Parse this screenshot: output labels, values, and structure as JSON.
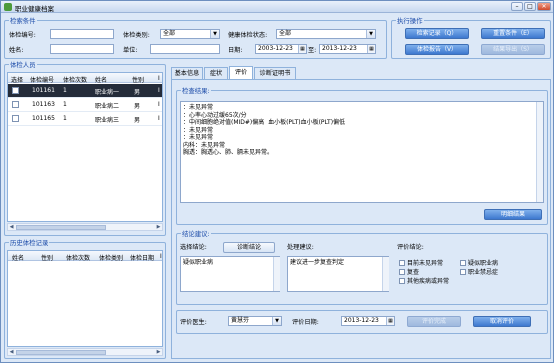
{
  "window": {
    "title": "职业健康档案",
    "min": "–",
    "max": "□",
    "close": "✕"
  },
  "search": {
    "legend": "检索条件",
    "exam_no_label": "体检编号:",
    "exam_no_value": "",
    "exam_type_label": "体检类别:",
    "exam_type_value": "全部",
    "health_status_label": "健康体检状态:",
    "health_status_value": "全部",
    "name_label": "姓名:",
    "name_value": "",
    "unit_label": "单位:",
    "unit_value": "",
    "date_label": "日期:",
    "date_from": "2003-12-23",
    "date_to_label": "至:",
    "date_to": "2013-12-23"
  },
  "actions": {
    "legend": "执行操作",
    "search_btn": "检索记录（Q）",
    "reset_btn": "重置条件（E）",
    "report_btn": "体检报告（V）",
    "export_btn": "结果导出（S）"
  },
  "people": {
    "legend": "体检人员",
    "columns": [
      "选择",
      "体检编号",
      "体检次数",
      "姓名",
      "性别",
      "I"
    ],
    "rows": [
      {
        "no": "101161",
        "count": "1",
        "name": "职业病一",
        "sex": "男",
        "extra": "I",
        "selected": true
      },
      {
        "no": "101163",
        "count": "1",
        "name": "职业病二",
        "sex": "男",
        "extra": "I",
        "selected": false
      },
      {
        "no": "101165",
        "count": "1",
        "name": "职业病三",
        "sex": "男",
        "extra": "I",
        "selected": false
      }
    ]
  },
  "history": {
    "legend": "历史体检记录",
    "columns": [
      "姓名",
      "性别",
      "体检次数",
      "体检类别",
      "体检日期",
      "I"
    ]
  },
  "tabs": [
    "基本信息",
    "症状",
    "评价",
    "诊断证明书"
  ],
  "active_tab": 2,
  "exam_result": {
    "legend": "检查结果:",
    "text": "：未见异常\n：心率心动过缓65次/分\n：中间细胞绝对值(MID#)偏高  血小板(PLT)血小板(PLT)偏低\n：未见异常\n：未见异常\n内科：未见异常\n胸透：胸透心、肺、膈未见异常。",
    "detail_btn": "明细结果"
  },
  "conclusion": {
    "legend": "结论建议:",
    "choose_label": "选择结论:",
    "diagnose_btn": "诊断结论",
    "conclusion_text": "疑似职业病",
    "advice_label": "处理建议:",
    "advice_text": "建议进一步复查判定",
    "eval_label": "评价结论:",
    "checks": [
      "目前未见异常",
      "疑似职业病",
      "复查",
      "职业禁忌症",
      "其他疾病或异常"
    ]
  },
  "footer": {
    "doctor_label": "评价医生:",
    "doctor_value": "黄慧芬",
    "date_label": "评价日期:",
    "date_value": "2013-12-23",
    "eval_save_btn": "评价完成",
    "cancel_btn": "取消评价"
  },
  "colors": {
    "accent": "#1a4aa8",
    "button": "#3d78cf",
    "selected_row": "#242c3a"
  }
}
